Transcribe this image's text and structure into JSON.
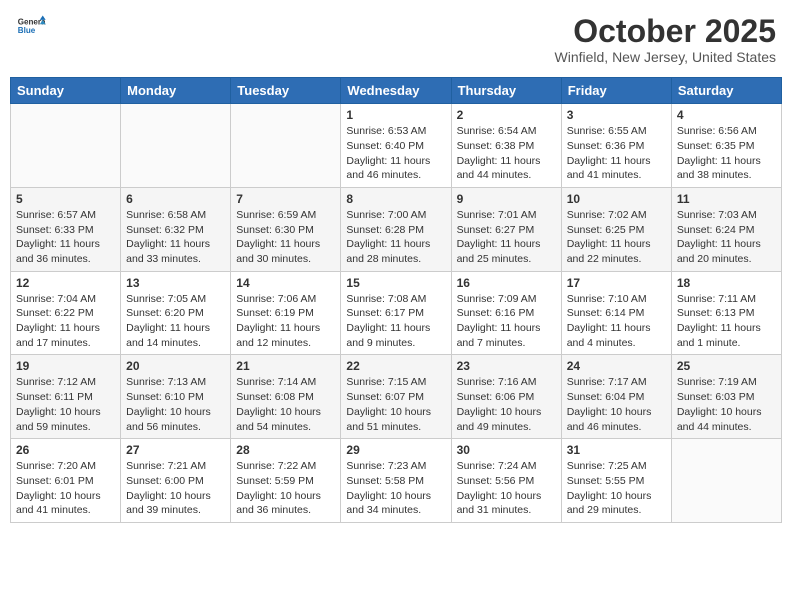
{
  "header": {
    "logo_general": "General",
    "logo_blue": "Blue",
    "month_title": "October 2025",
    "location": "Winfield, New Jersey, United States"
  },
  "days_of_week": [
    "Sunday",
    "Monday",
    "Tuesday",
    "Wednesday",
    "Thursday",
    "Friday",
    "Saturday"
  ],
  "weeks": [
    [
      {
        "day": "",
        "info": ""
      },
      {
        "day": "",
        "info": ""
      },
      {
        "day": "",
        "info": ""
      },
      {
        "day": "1",
        "info": "Sunrise: 6:53 AM\nSunset: 6:40 PM\nDaylight: 11 hours and 46 minutes."
      },
      {
        "day": "2",
        "info": "Sunrise: 6:54 AM\nSunset: 6:38 PM\nDaylight: 11 hours and 44 minutes."
      },
      {
        "day": "3",
        "info": "Sunrise: 6:55 AM\nSunset: 6:36 PM\nDaylight: 11 hours and 41 minutes."
      },
      {
        "day": "4",
        "info": "Sunrise: 6:56 AM\nSunset: 6:35 PM\nDaylight: 11 hours and 38 minutes."
      }
    ],
    [
      {
        "day": "5",
        "info": "Sunrise: 6:57 AM\nSunset: 6:33 PM\nDaylight: 11 hours and 36 minutes."
      },
      {
        "day": "6",
        "info": "Sunrise: 6:58 AM\nSunset: 6:32 PM\nDaylight: 11 hours and 33 minutes."
      },
      {
        "day": "7",
        "info": "Sunrise: 6:59 AM\nSunset: 6:30 PM\nDaylight: 11 hours and 30 minutes."
      },
      {
        "day": "8",
        "info": "Sunrise: 7:00 AM\nSunset: 6:28 PM\nDaylight: 11 hours and 28 minutes."
      },
      {
        "day": "9",
        "info": "Sunrise: 7:01 AM\nSunset: 6:27 PM\nDaylight: 11 hours and 25 minutes."
      },
      {
        "day": "10",
        "info": "Sunrise: 7:02 AM\nSunset: 6:25 PM\nDaylight: 11 hours and 22 minutes."
      },
      {
        "day": "11",
        "info": "Sunrise: 7:03 AM\nSunset: 6:24 PM\nDaylight: 11 hours and 20 minutes."
      }
    ],
    [
      {
        "day": "12",
        "info": "Sunrise: 7:04 AM\nSunset: 6:22 PM\nDaylight: 11 hours and 17 minutes."
      },
      {
        "day": "13",
        "info": "Sunrise: 7:05 AM\nSunset: 6:20 PM\nDaylight: 11 hours and 14 minutes."
      },
      {
        "day": "14",
        "info": "Sunrise: 7:06 AM\nSunset: 6:19 PM\nDaylight: 11 hours and 12 minutes."
      },
      {
        "day": "15",
        "info": "Sunrise: 7:08 AM\nSunset: 6:17 PM\nDaylight: 11 hours and 9 minutes."
      },
      {
        "day": "16",
        "info": "Sunrise: 7:09 AM\nSunset: 6:16 PM\nDaylight: 11 hours and 7 minutes."
      },
      {
        "day": "17",
        "info": "Sunrise: 7:10 AM\nSunset: 6:14 PM\nDaylight: 11 hours and 4 minutes."
      },
      {
        "day": "18",
        "info": "Sunrise: 7:11 AM\nSunset: 6:13 PM\nDaylight: 11 hours and 1 minute."
      }
    ],
    [
      {
        "day": "19",
        "info": "Sunrise: 7:12 AM\nSunset: 6:11 PM\nDaylight: 10 hours and 59 minutes."
      },
      {
        "day": "20",
        "info": "Sunrise: 7:13 AM\nSunset: 6:10 PM\nDaylight: 10 hours and 56 minutes."
      },
      {
        "day": "21",
        "info": "Sunrise: 7:14 AM\nSunset: 6:08 PM\nDaylight: 10 hours and 54 minutes."
      },
      {
        "day": "22",
        "info": "Sunrise: 7:15 AM\nSunset: 6:07 PM\nDaylight: 10 hours and 51 minutes."
      },
      {
        "day": "23",
        "info": "Sunrise: 7:16 AM\nSunset: 6:06 PM\nDaylight: 10 hours and 49 minutes."
      },
      {
        "day": "24",
        "info": "Sunrise: 7:17 AM\nSunset: 6:04 PM\nDaylight: 10 hours and 46 minutes."
      },
      {
        "day": "25",
        "info": "Sunrise: 7:19 AM\nSunset: 6:03 PM\nDaylight: 10 hours and 44 minutes."
      }
    ],
    [
      {
        "day": "26",
        "info": "Sunrise: 7:20 AM\nSunset: 6:01 PM\nDaylight: 10 hours and 41 minutes."
      },
      {
        "day": "27",
        "info": "Sunrise: 7:21 AM\nSunset: 6:00 PM\nDaylight: 10 hours and 39 minutes."
      },
      {
        "day": "28",
        "info": "Sunrise: 7:22 AM\nSunset: 5:59 PM\nDaylight: 10 hours and 36 minutes."
      },
      {
        "day": "29",
        "info": "Sunrise: 7:23 AM\nSunset: 5:58 PM\nDaylight: 10 hours and 34 minutes."
      },
      {
        "day": "30",
        "info": "Sunrise: 7:24 AM\nSunset: 5:56 PM\nDaylight: 10 hours and 31 minutes."
      },
      {
        "day": "31",
        "info": "Sunrise: 7:25 AM\nSunset: 5:55 PM\nDaylight: 10 hours and 29 minutes."
      },
      {
        "day": "",
        "info": ""
      }
    ]
  ]
}
